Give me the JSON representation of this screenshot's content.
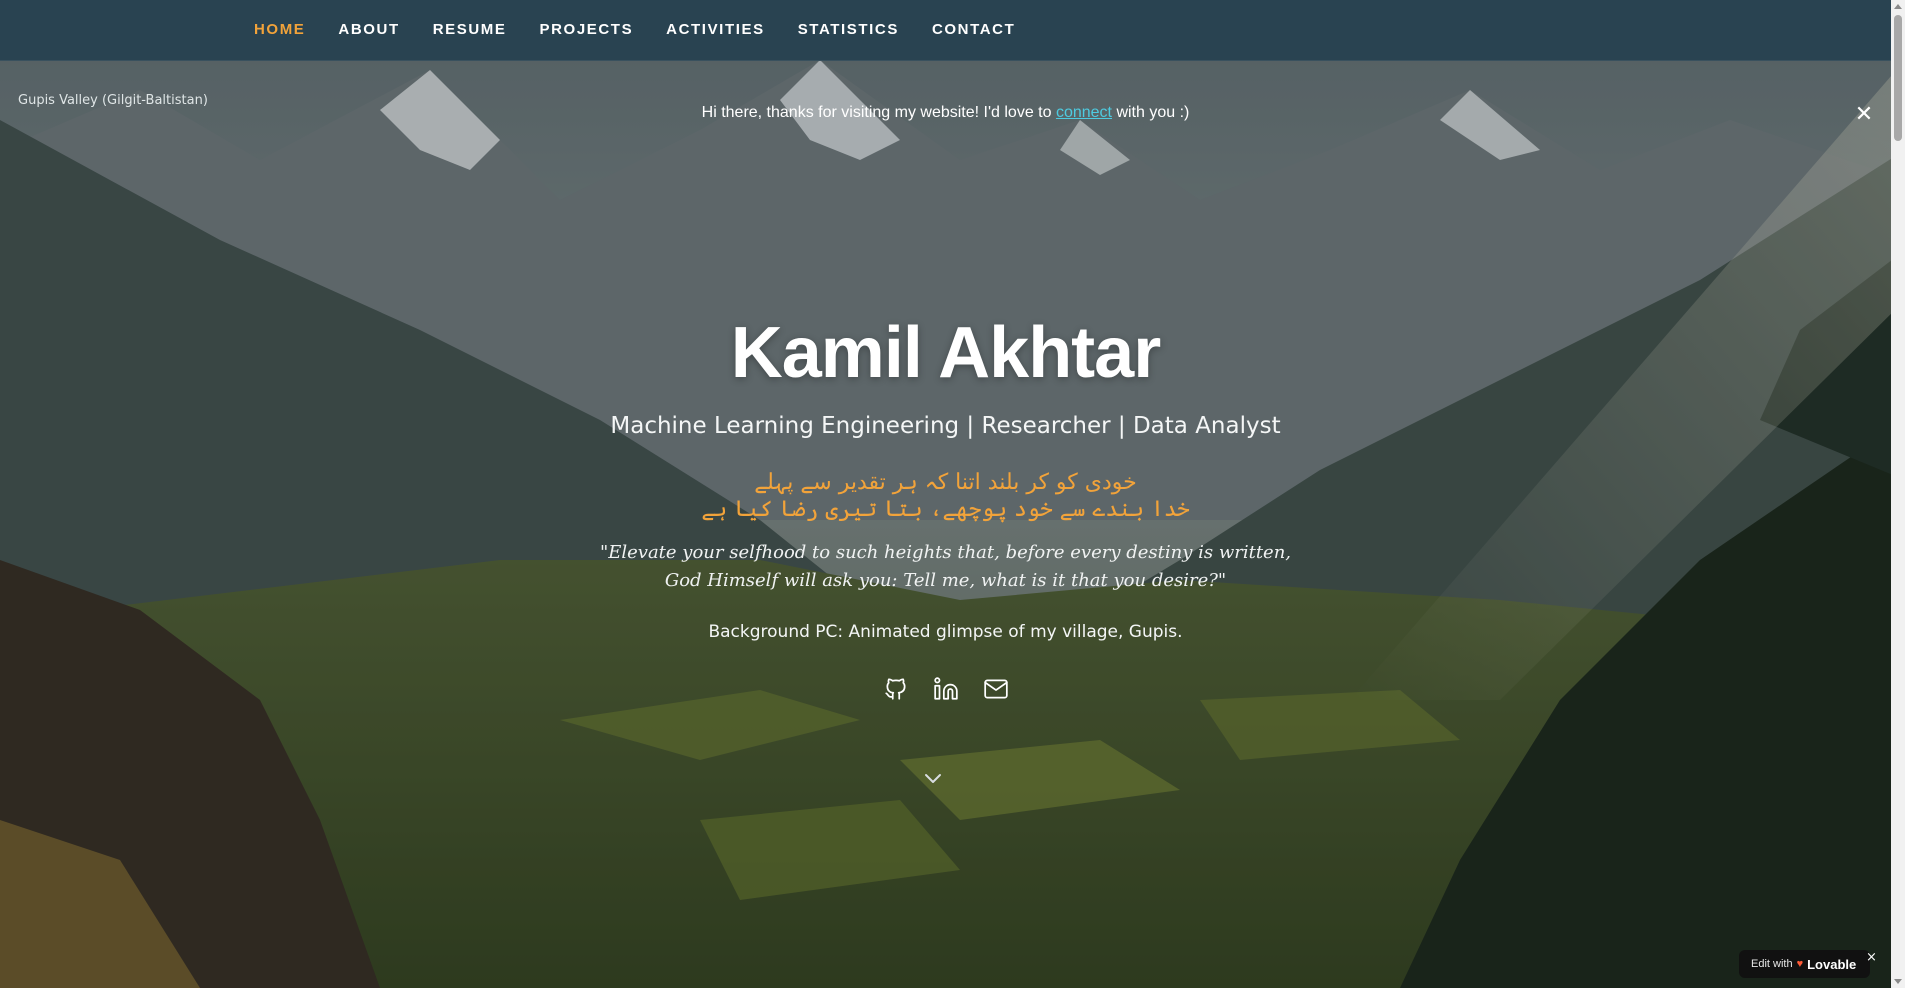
{
  "nav": {
    "items": [
      {
        "label": "HOME",
        "active": true
      },
      {
        "label": "ABOUT",
        "active": false
      },
      {
        "label": "RESUME",
        "active": false
      },
      {
        "label": "PROJECTS",
        "active": false
      },
      {
        "label": "ACTIVITIES",
        "active": false
      },
      {
        "label": "STATISTICS",
        "active": false
      },
      {
        "label": "CONTACT",
        "active": false
      }
    ]
  },
  "location_caption": "Gupis Valley (Gilgit-Baltistan)",
  "banner": {
    "text_before": "Hi there, thanks for visiting my website! I'd love to ",
    "link_text": "connect",
    "text_after": " with you :)",
    "close_glyph": "✕"
  },
  "hero": {
    "name": "Kamil Akhtar",
    "role": "Machine Learning Engineering | Researcher | Data Analyst",
    "urdu_line_1": "خودی کو کر بلند اتنا کہ ہر تقدیر سے پہلے",
    "urdu_line_2": "خدا بندے سے خود پوچھے، بتا تیری رضا کیا ہے",
    "quote_line_1": "\"Elevate your selfhood to such heights that, before every destiny is written,",
    "quote_line_2": "God Himself will ask you: Tell me, what is it that you desire?\"",
    "background_note": "Background PC: Animated glimpse of my village, Gupis."
  },
  "socials": [
    {
      "icon": "github-icon"
    },
    {
      "icon": "linkedin-icon"
    },
    {
      "icon": "mail-icon"
    }
  ],
  "scroll_down_icon": "chevron-down-icon",
  "lovable_badge": {
    "prefix": "Edit with",
    "brand": "Lovable",
    "close_glyph": "×"
  },
  "colors": {
    "accent": "#f2a33a",
    "link": "#4ecbe0",
    "navbar": "#284250"
  }
}
